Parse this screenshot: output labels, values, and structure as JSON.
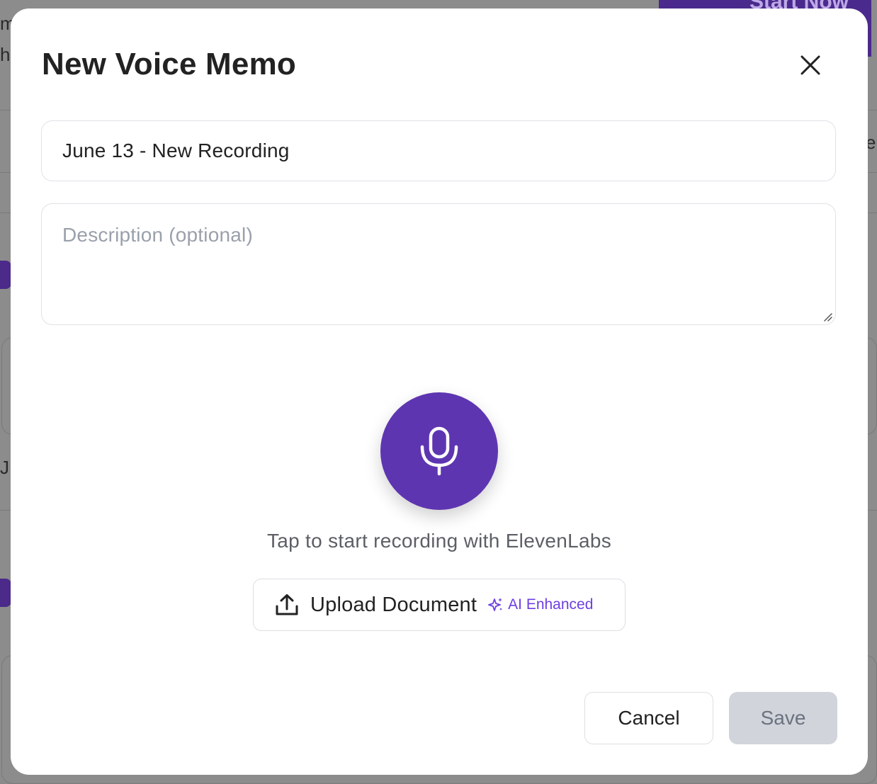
{
  "background": {
    "cta_label": "Start Now",
    "fragments": [
      "m",
      "h",
      "J",
      "er"
    ]
  },
  "modal": {
    "title": "New Voice Memo",
    "close_icon": "close-icon",
    "title_field": {
      "value": "June 13 - New Recording"
    },
    "description_field": {
      "placeholder": "Description (optional)"
    },
    "record": {
      "icon": "microphone-icon",
      "hint": "Tap to start recording with ElevenLabs"
    },
    "upload": {
      "label": "Upload Document",
      "icon": "upload-icon",
      "badge": {
        "label": "AI Enhanced",
        "icon": "sparkles-icon"
      }
    },
    "footer": {
      "cancel_label": "Cancel",
      "save_label": "Save"
    }
  },
  "colors": {
    "accent": "#5e35b1",
    "badge": "#6d3fe0",
    "save_disabled_bg": "#d1d5db",
    "overlay": "#8c8c8c"
  }
}
